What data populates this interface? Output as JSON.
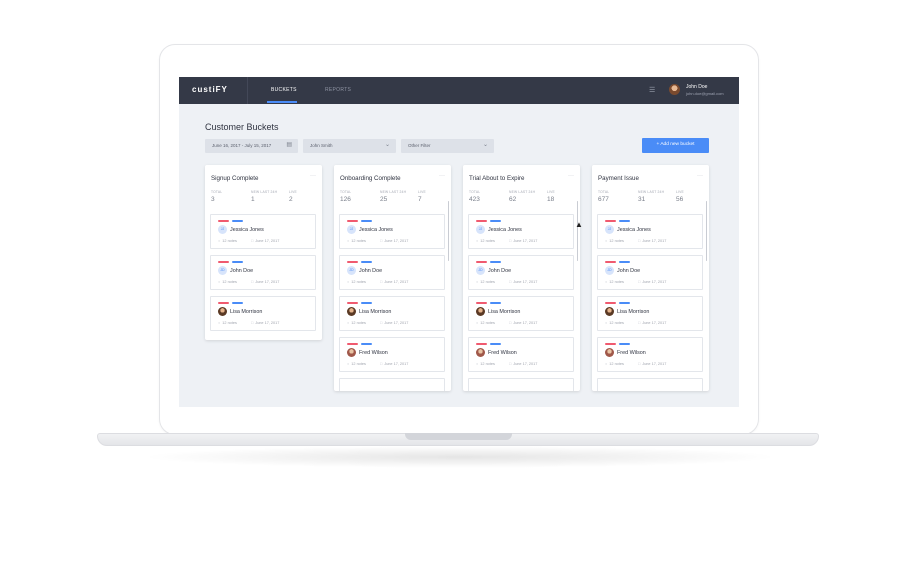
{
  "app": {
    "logo": "custiFY",
    "nav_tabs": [
      {
        "label": "BUCKETS",
        "active": true
      },
      {
        "label": "REPORTS",
        "active": false
      }
    ],
    "user": {
      "name": "John Doe",
      "email": "john.doe@gmail.com"
    }
  },
  "page": {
    "title": "Customer Buckets",
    "filters": {
      "date_range": "June 16, 2017 - July 15, 2017",
      "owner": "John Smith",
      "other": "Other Filter"
    },
    "add_button": "+ Add new bucket"
  },
  "stat_labels": {
    "total": "TOTAL",
    "new": "NEW LAST 24H",
    "live": "LIVE"
  },
  "buckets": [
    {
      "title": "Signup Complete",
      "total": "3",
      "new": "1",
      "live": "2",
      "cards": [
        {
          "initials": "JJ",
          "name": "Jessica Jones",
          "notes": "12 notes",
          "date": "June 17, 2017"
        },
        {
          "initials": "JD",
          "name": "John Doe",
          "notes": "12 notes",
          "date": "June 17, 2017"
        },
        {
          "initials": "",
          "name": "Lisa Morrison",
          "notes": "12 notes",
          "date": "June 17, 2017"
        }
      ]
    },
    {
      "title": "Onboarding Complete",
      "total": "126",
      "new": "25",
      "live": "7",
      "cards": [
        {
          "initials": "JJ",
          "name": "Jessica Jones",
          "notes": "12 notes",
          "date": "June 17, 2017"
        },
        {
          "initials": "JD",
          "name": "John Doe",
          "notes": "12 notes",
          "date": "June 17, 2017"
        },
        {
          "initials": "",
          "name": "Lisa Morrison",
          "notes": "12 notes",
          "date": "June 17, 2017"
        },
        {
          "initials": "",
          "name": "Fred Wilson",
          "notes": "12 notes",
          "date": "June 17, 2017"
        }
      ]
    },
    {
      "title": "Trial About to Expire",
      "total": "423",
      "new": "62",
      "live": "18",
      "cards": [
        {
          "initials": "JJ",
          "name": "Jessica Jones",
          "notes": "12 notes",
          "date": "June 17, 2017"
        },
        {
          "initials": "JD",
          "name": "John Doe",
          "notes": "12 notes",
          "date": "June 17, 2017"
        },
        {
          "initials": "",
          "name": "Lisa Morrison",
          "notes": "12 notes",
          "date": "June 17, 2017"
        },
        {
          "initials": "",
          "name": "Fred Wilson",
          "notes": "12 notes",
          "date": "June 17, 2017"
        }
      ]
    },
    {
      "title": "Payment Issue",
      "total": "677",
      "new": "31",
      "live": "56",
      "cards": [
        {
          "initials": "JJ",
          "name": "Jessica Jones",
          "notes": "12 notes",
          "date": "June 17, 2017"
        },
        {
          "initials": "JD",
          "name": "John Doe",
          "notes": "12 notes",
          "date": "June 17, 2017"
        },
        {
          "initials": "",
          "name": "Lisa Morrison",
          "notes": "12 notes",
          "date": "June 17, 2017"
        },
        {
          "initials": "",
          "name": "Fred Wilson",
          "notes": "12 notes",
          "date": "June 17, 2017"
        }
      ]
    }
  ],
  "colors": {
    "accent": "#4a8cf7",
    "tag_red": "#f05a6f",
    "nav_bg": "#343947"
  }
}
